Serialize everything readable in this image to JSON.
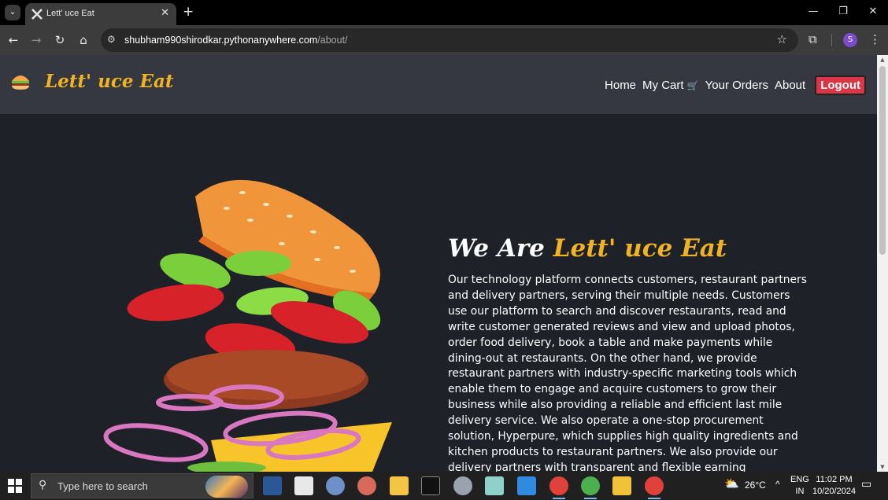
{
  "browser": {
    "tab_title": "Lett' uce Eat",
    "url_host": "shubham990shirodkar.pythonanywhere.com",
    "url_path": "/about/",
    "profile_initial": "S"
  },
  "navbar": {
    "brand": "Lett' uce Eat",
    "links": {
      "home": "Home",
      "cart": "My Cart",
      "orders": "Your Orders",
      "about": "About"
    },
    "logout": "Logout"
  },
  "about": {
    "heading_prefix": "We Are",
    "heading_brand": "Lett' uce Eat",
    "body": "Our technology platform connects customers, restaurant partners and delivery partners, serving their multiple needs. Customers use our platform to search and discover restaurants, read and write customer generated reviews and view and upload photos, order food delivery, book a table and make payments while dining-out at restaurants. On the other hand, we provide restaurant partners with industry-specific marketing tools which enable them to engage and acquire customers to grow their business while also providing a reliable and efficient last mile delivery service. We also operate a one-stop procurement solution, Hyperpure, which supplies high quality ingredients and kitchen products to restaurant partners. We also provide our delivery partners with transparent and flexible earning opportunities."
  },
  "taskbar": {
    "search_placeholder": "Type here to search",
    "weather": "26°C",
    "lang": "ENG",
    "region": "IN",
    "time": "11:02 PM",
    "date": "10/20/2024"
  },
  "colors": {
    "accent": "#f0b323",
    "logout": "#dc3545",
    "navbar": "#353841",
    "page_bg": "#1f2129"
  }
}
